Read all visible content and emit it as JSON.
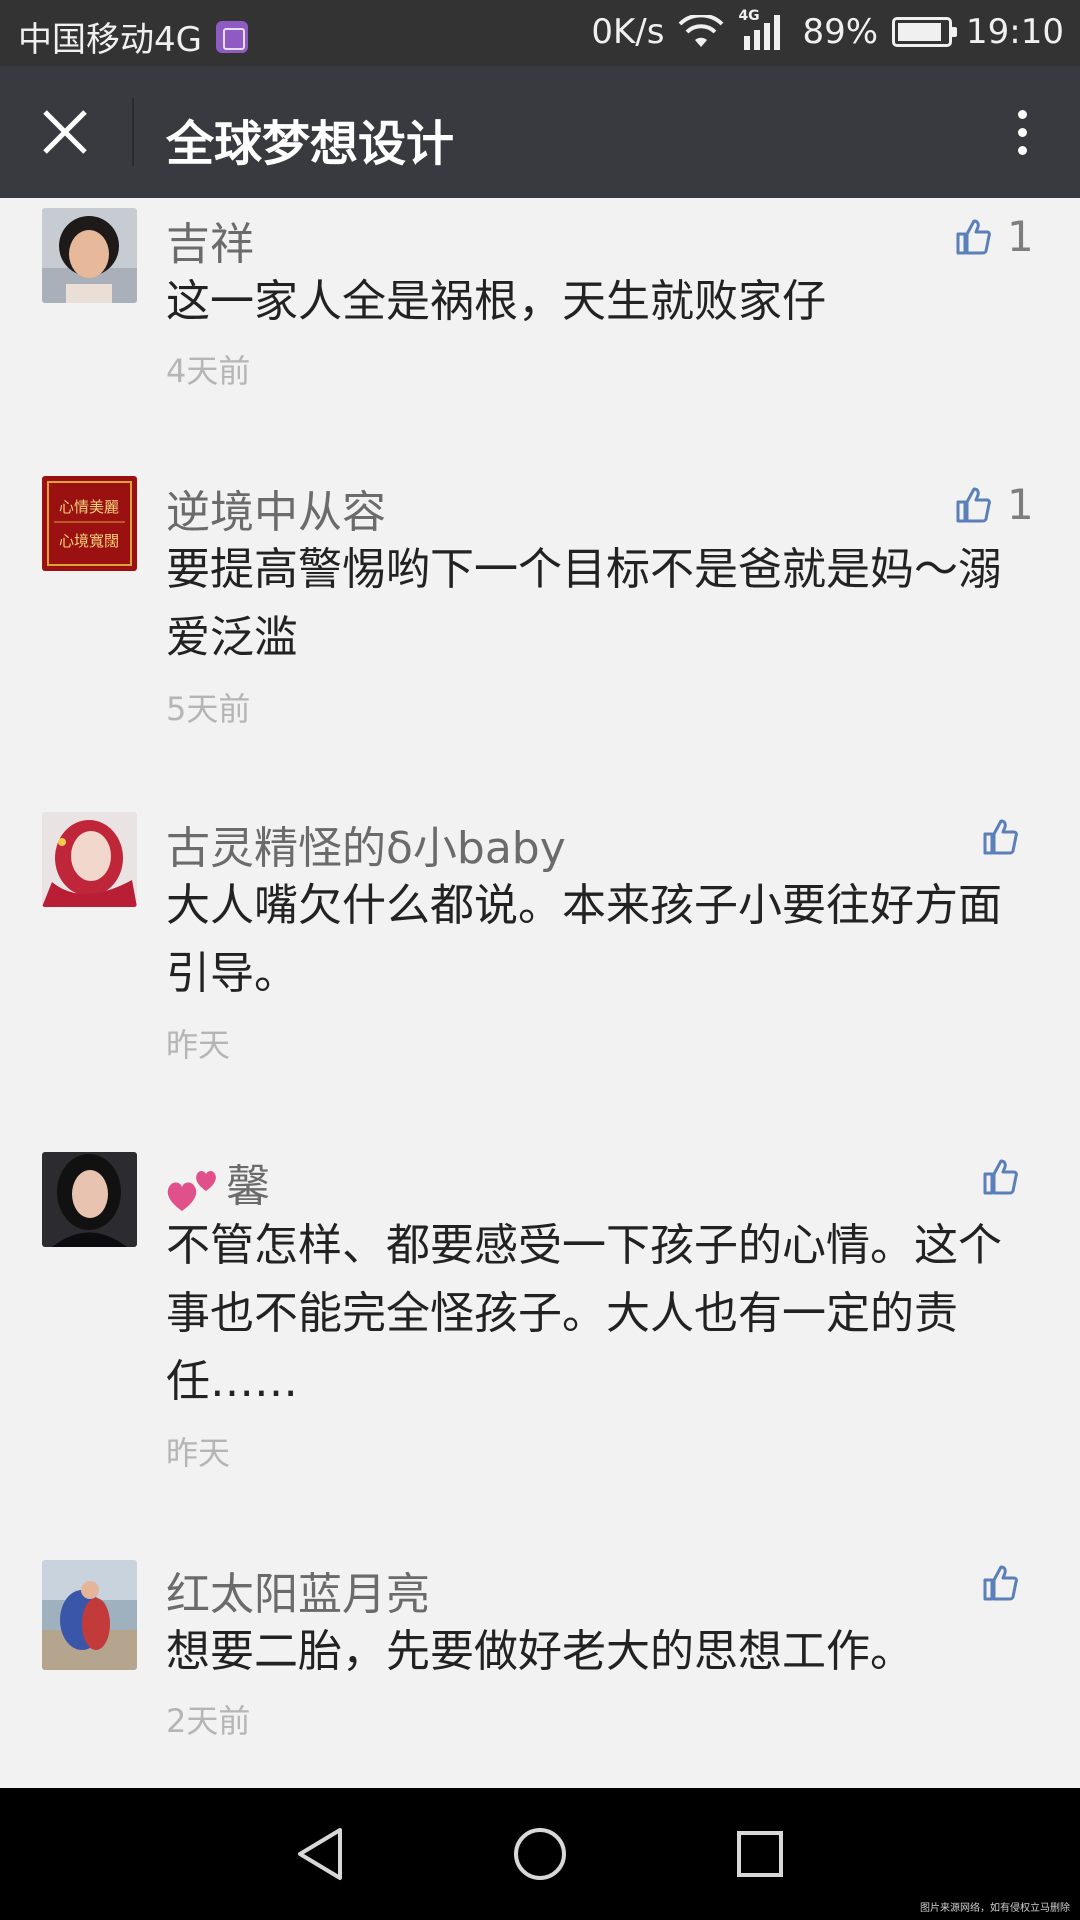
{
  "status_bar": {
    "carrier": "中国移动4G",
    "speed": "0K/s",
    "network": "4G",
    "battery_percent": "89%",
    "battery_level": 0.89,
    "time": "19:10"
  },
  "header": {
    "title": "全球梦想设计"
  },
  "comments": [
    {
      "name": "吉祥",
      "text": "这一家人全是祸根，天生就败家仔",
      "time": "4天前",
      "likes": "1",
      "avatar": "avatar-woman-short-hair"
    },
    {
      "name": "逆境中从容",
      "text": "要提高警惕哟下一个目标不是爸就是妈～溺爱泛滥",
      "time": "5天前",
      "likes": "1",
      "avatar": "avatar-red-calligraphy",
      "avatar_lines": [
        "心情美麗",
        "心境寬闊"
      ]
    },
    {
      "name": "古灵精怪的δ小baby",
      "text": "大人嘴欠什么都说。本来孩子小要往好方面引导。",
      "time": "昨天",
      "likes": "",
      "avatar": "avatar-girl-red-scarf"
    },
    {
      "name": "馨",
      "text": "不管怎样、都要感受一下孩子的心情。这个事也不能完全怪孩子。大人也有一定的责任……",
      "time": "昨天",
      "likes": "",
      "avatar": "avatar-woman-dark-hair",
      "name_prefix_icon": "hearts-icon"
    },
    {
      "name": "红太阳蓝月亮",
      "text": "想要二胎，先要做好老大的思想工作。",
      "time": "2天前",
      "likes": "",
      "avatar": "avatar-woman-scarf-seaside"
    }
  ],
  "colors": {
    "status_bar_bg": "#333334",
    "title_bar_bg": "#393a3f",
    "page_bg": "#f2f2f2",
    "like_icon": "#5b7fb8",
    "heart": "#e0508a"
  },
  "watermark": "图片来源网络，如有侵权立马删除"
}
